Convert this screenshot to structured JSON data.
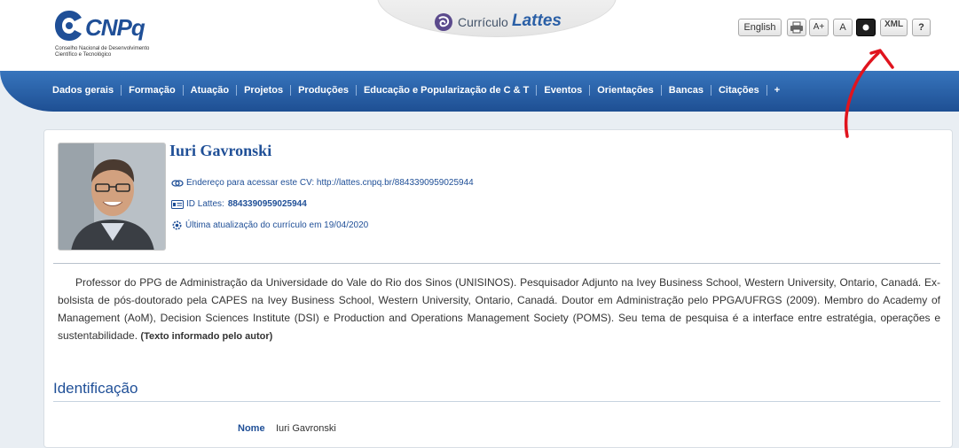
{
  "header": {
    "logo_text": "CNPq",
    "logo_subtitle": "Conselho Nacional de Desenvolvimento Científico e Tecnológico",
    "app_title_prefix": "Currículo",
    "app_title_main": "Lattes",
    "tools": {
      "english": "English",
      "print_icon": "printer-icon",
      "font_increase": "A+",
      "font_normal": "A",
      "contrast_icon": "contrast-icon",
      "xml": "XML",
      "help": "?"
    }
  },
  "nav": {
    "items": [
      "Dados gerais",
      "Formação",
      "Atuação",
      "Projetos",
      "Produções",
      "Educação e Popularização de C & T",
      "Eventos",
      "Orientações",
      "Bancas",
      "Citações",
      "+"
    ]
  },
  "profile": {
    "name": "Iuri Gavronski",
    "cv_address_label": "Endereço para acessar este CV: http://lattes.cnpq.br/8843390959025944",
    "id_label": "ID Lattes:",
    "id_value": "8843390959025944",
    "updated": "Última atualização do currículo em 19/04/2020"
  },
  "bio": {
    "text": "Professor do PPG de Administração da Universidade do Vale do Rio dos Sinos (UNISINOS). Pesquisador Adjunto na Ivey Business School, Western University, Ontario, Canadá. Ex-bolsista de pós-doutorado pela CAPES na Ivey Business School, Western University, Ontario, Canadá. Doutor em Administração pelo PPGA/UFRGS (2009). Membro do Academy of Management (AoM), Decision Sciences Institute (DSI) e Production and Operations Management Society (POMS). Seu tema de pesquisa é a interface entre estratégia, operações e sustentabilidade.",
    "author_note": "(Texto informado pelo autor)"
  },
  "identification": {
    "title": "Identificação",
    "name_label": "Nome",
    "name_value": "Iuri Gavronski"
  },
  "colors": {
    "brand_blue": "#1f4f97",
    "nav_top": "#3775bd",
    "nav_bottom": "#1e4f93",
    "annotation_red": "#e0141e"
  }
}
